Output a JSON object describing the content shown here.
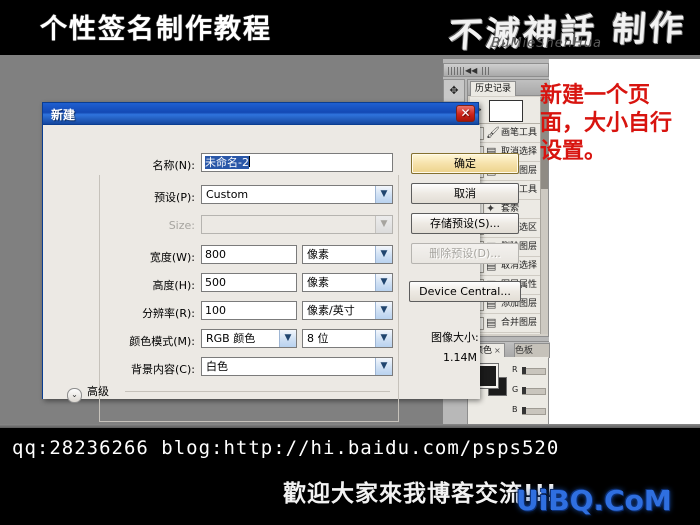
{
  "banner": {
    "title": "个性签名制作教程",
    "logo_main": "不滅神話 制作",
    "logo_sub": "BuMieShenHua"
  },
  "annotation": {
    "text": "新建一个页面，大小自行设置。",
    "color": "#d8140f"
  },
  "dialog": {
    "title": "新建",
    "close_icon": "close-icon",
    "close_glyph": "✕",
    "fields": {
      "name_label": "名称(N):",
      "name_value": "未命名-2",
      "preset_label": "预设(P):",
      "preset_value": "Custom",
      "size_label": "Size:",
      "size_value": "",
      "width_label": "宽度(W):",
      "width_value": "800",
      "width_unit": "像素",
      "height_label": "高度(H):",
      "height_value": "500",
      "height_unit": "像素",
      "resolution_label": "分辨率(R):",
      "resolution_value": "100",
      "resolution_unit": "像素/英寸",
      "colormode_label": "颜色模式(M):",
      "colormode_value": "RGB 颜色",
      "bitdepth_value": "8 位",
      "background_label": "背景内容(C):",
      "background_value": "白色"
    },
    "buttons": {
      "ok": "确定",
      "cancel": "取消",
      "save_preset": "存储预设(S)...",
      "delete_preset": "删除预设(D)...",
      "device_central": "Device Central..."
    },
    "image_size": {
      "label": "图像大小:",
      "value": "1.14M"
    },
    "advanced_label": "高级",
    "advanced_chevron": "⌄"
  },
  "panels": {
    "history": {
      "tab_label": "历史记录",
      "snapshot_icon": "snapshot-icon",
      "rows": [
        {
          "icon": "brush-icon",
          "label": "画笔工具"
        },
        {
          "icon": "layer-icon",
          "label": "取消选择"
        },
        {
          "icon": "layer-icon",
          "label": "新建图层"
        },
        {
          "icon": "brush-icon",
          "label": "画笔工具"
        },
        {
          "icon": "lasso-icon",
          "label": "套索"
        },
        {
          "icon": "layer-icon",
          "label": "变换选区"
        },
        {
          "icon": "layer-icon",
          "label": "删除图层"
        },
        {
          "icon": "layer-icon",
          "label": "取消选择"
        },
        {
          "icon": "layer-icon",
          "label": "图层属性"
        },
        {
          "icon": "layer-icon",
          "label": "添加图层"
        },
        {
          "icon": "layer-icon",
          "label": "合并图层"
        }
      ]
    },
    "color": {
      "tab_label": "颜色",
      "tab_close": "×",
      "tab2_label": "色板",
      "channels": [
        "R",
        "G",
        "B"
      ],
      "foreground": "#1b1b1b",
      "background": "#1b1b1b"
    },
    "tools": [
      "move-icon",
      "marquee-icon",
      "lasso-icon",
      "wand-icon",
      "crop-icon",
      "eyedropper-icon",
      "heal-icon",
      "brush-icon",
      "stamp-icon",
      "history-brush-icon",
      "eraser-icon",
      "gradient-icon"
    ]
  },
  "footer": {
    "line1": "qq:28236266  blog:http://hi.baidu.com/psps520",
    "line2": "歡迎大家來我博客交流!!!",
    "watermark": "UiBQ.CoM",
    "watermark_color": "#2f6fe0"
  }
}
